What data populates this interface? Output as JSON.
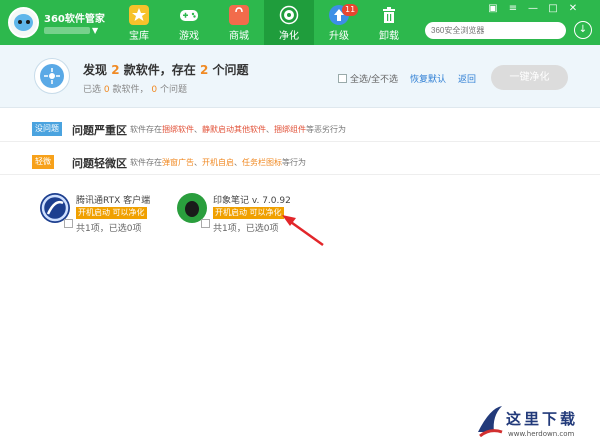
{
  "header": {
    "app_title": "360软件管家",
    "nav": [
      {
        "label": "宝库",
        "icon": "star-icon"
      },
      {
        "label": "游戏",
        "icon": "gamepad-icon"
      },
      {
        "label": "商城",
        "icon": "shopping-bag-icon"
      },
      {
        "label": "净化",
        "icon": "purify-icon",
        "active": true
      },
      {
        "label": "升级",
        "icon": "upgrade-arrow-icon",
        "badge": "11"
      },
      {
        "label": "卸载",
        "icon": "trash-icon"
      }
    ],
    "search_placeholder": "360安全浏览器",
    "colors": {
      "brand": "#2db84d",
      "active_tab": "#1f9d3c"
    }
  },
  "summary": {
    "title_pre": "发现",
    "title_count": "2",
    "title_mid": "款软件，存在",
    "title_issues": "2",
    "title_post": "个问题",
    "sub_pre": "已选",
    "sub_selected_software": "0",
    "sub_mid": "款软件，",
    "sub_selected_issues": "0",
    "sub_post": "个问题",
    "select_all": "全选/全不选",
    "restore_link": "恢复默认",
    "back_link": "返回",
    "purify_button": "一键净化"
  },
  "categories": {
    "severe": {
      "badge": "没问题",
      "title": "问题严重区",
      "desc_pre": "软件存在",
      "desc_a": "捆绑软件",
      "desc_b": "静默启动其他软件",
      "desc_c": "捆绑组件",
      "desc_post": "等恶劣行为",
      "color": "#4aa3df"
    },
    "minor": {
      "badge": "轻微",
      "title": "问题轻微区",
      "desc_pre": "软件存在",
      "desc_a": "弹窗广告",
      "desc_b": "开机自启",
      "desc_c": "任务栏图标",
      "desc_post": "等行为",
      "color": "#f7a11a"
    }
  },
  "apps": [
    {
      "name": "腾讯通RTX 客户端",
      "tag": "开机启动 可以净化",
      "count": "共1项，已选0项",
      "icon": "rtx-logo-icon"
    },
    {
      "name": "印象笔记 v. 7.0.92",
      "tag": "开机启动 可以净化",
      "count": "共1项，已选0项",
      "icon": "evernote-elephant-icon"
    }
  ],
  "watermark": {
    "text": "这里下载",
    "url": "www.herdown.com"
  }
}
